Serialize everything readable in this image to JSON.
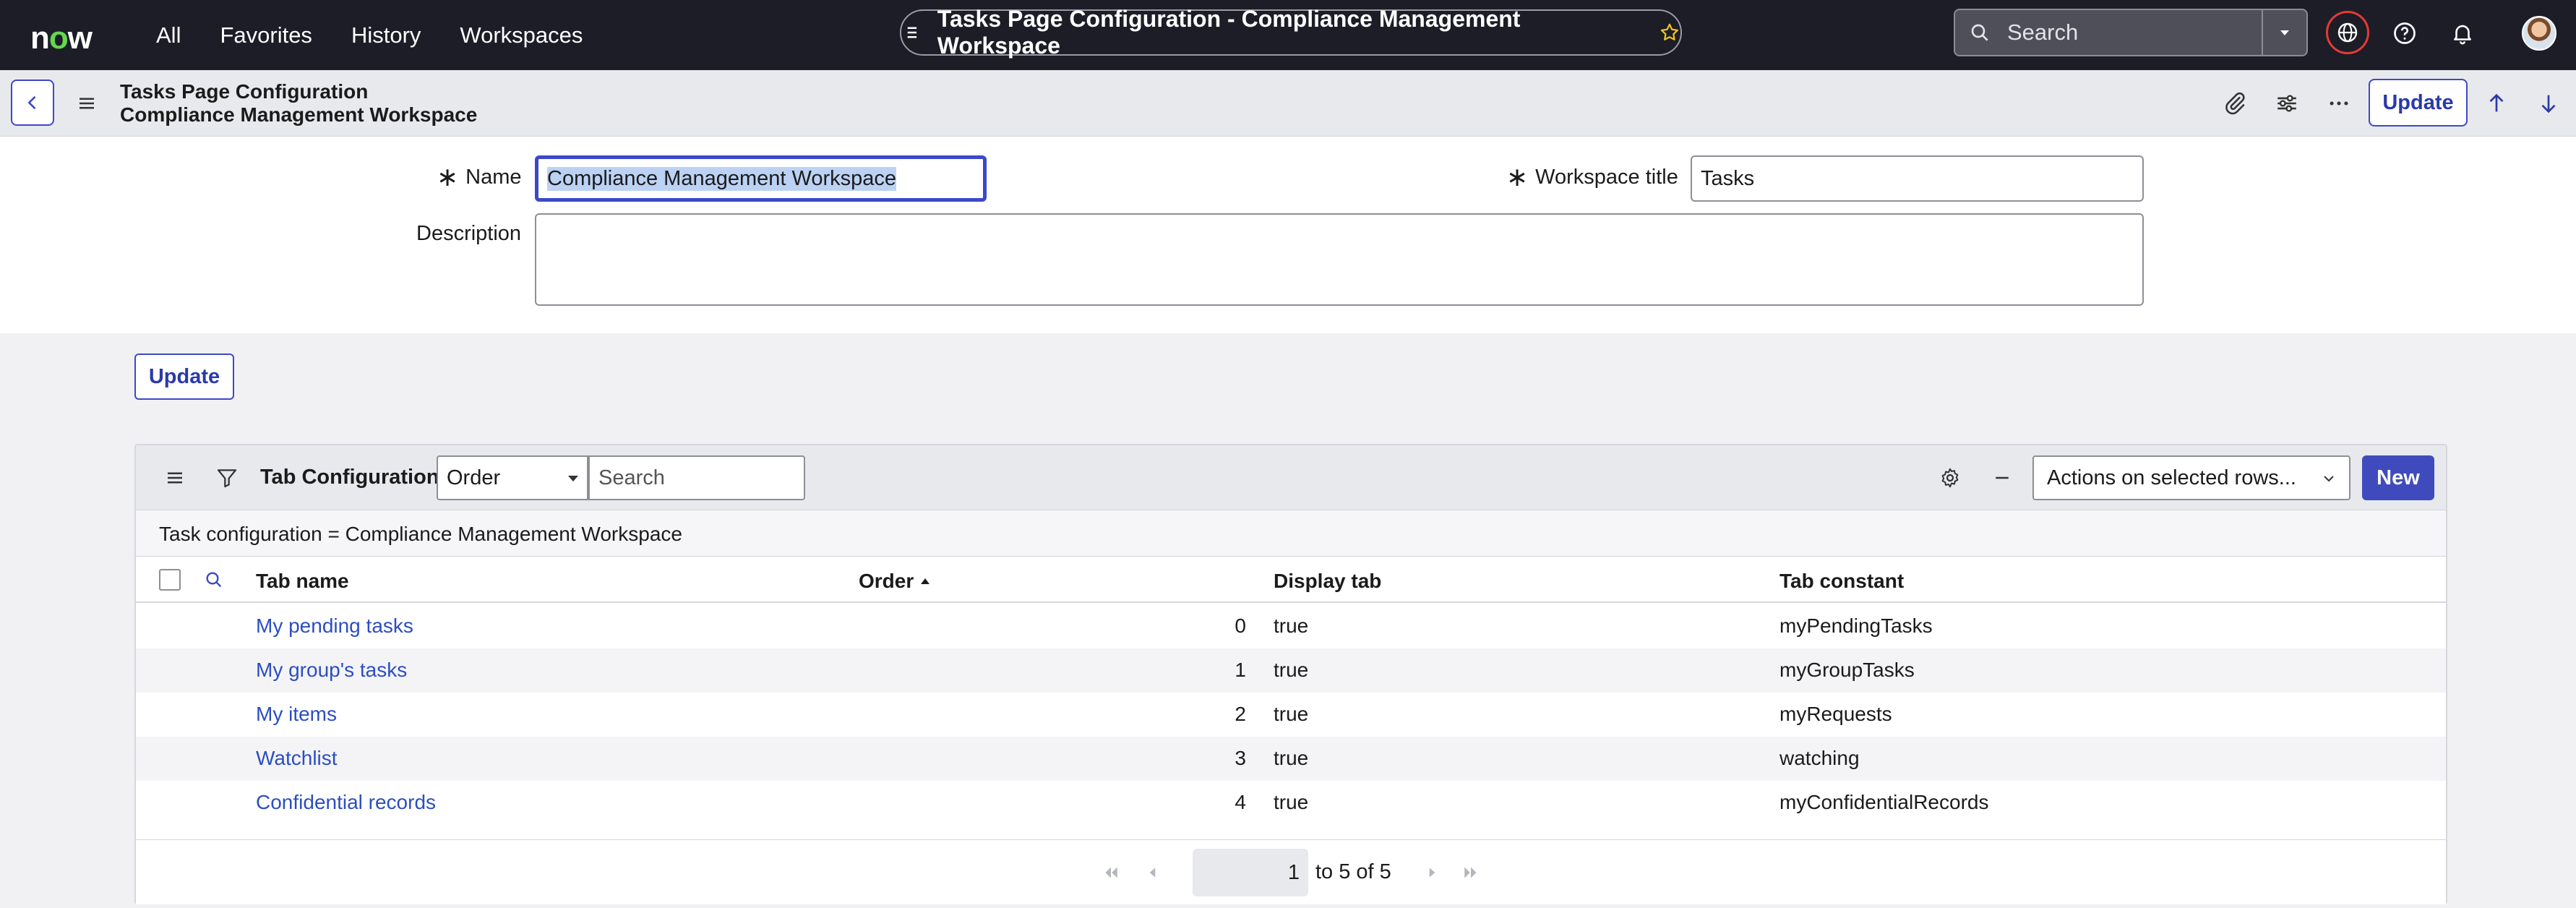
{
  "topnav": {
    "logo": "now",
    "links": [
      "All",
      "Favorites",
      "History",
      "Workspaces"
    ],
    "title": "Tasks Page Configuration - Compliance Management Workspace",
    "search_placeholder": "Search"
  },
  "form_header": {
    "title_line1": "Tasks Page Configuration",
    "title_line2": "Compliance Management Workspace",
    "update_label": "Update"
  },
  "form": {
    "name_label": "Name",
    "name_value": "Compliance Management Workspace",
    "workspace_title_label": "Workspace title",
    "workspace_title_value": "Tasks",
    "description_label": "Description",
    "description_value": ""
  },
  "update_button": "Update",
  "related_list": {
    "title": "Tab Configurations",
    "order_select_value": "Order",
    "search_placeholder": "Search",
    "actions_placeholder": "Actions on selected rows...",
    "new_label": "New",
    "breadcrumb": "Task configuration = Compliance Management Workspace",
    "columns": {
      "tab_name": "Tab name",
      "order": "Order",
      "display_tab": "Display tab",
      "tab_constant": "Tab constant"
    },
    "rows": [
      {
        "tab_name": "My pending tasks",
        "order": "0",
        "display_tab": "true",
        "tab_constant": "myPendingTasks"
      },
      {
        "tab_name": "My group's tasks",
        "order": "1",
        "display_tab": "true",
        "tab_constant": "myGroupTasks"
      },
      {
        "tab_name": "My items",
        "order": "2",
        "display_tab": "true",
        "tab_constant": "myRequests"
      },
      {
        "tab_name": "Watchlist",
        "order": "3",
        "display_tab": "true",
        "tab_constant": "watching"
      },
      {
        "tab_name": "Confidential records",
        "order": "4",
        "display_tab": "true",
        "tab_constant": "myConfidentialRecords"
      }
    ],
    "pager": {
      "page_value": "1",
      "range_text": "to 5 of 5"
    }
  },
  "colors": {
    "nav_bg": "#1c1d27",
    "accent": "#3b49c9",
    "link": "#2b4ec2",
    "logo_o": "#62d84e",
    "globe_ring": "#e53935"
  },
  "icons": [
    "menu-icon",
    "star-icon",
    "search-icon",
    "dropdown-caret-icon",
    "globe-icon",
    "help-icon",
    "bell-icon",
    "back-chevron-icon",
    "paperclip-icon",
    "sliders-icon",
    "more-icon",
    "arrow-up-icon",
    "arrow-down-icon",
    "filter-icon",
    "gear-icon",
    "minus-icon",
    "first-page-icon",
    "prev-page-icon",
    "next-page-icon",
    "last-page-icon"
  ]
}
